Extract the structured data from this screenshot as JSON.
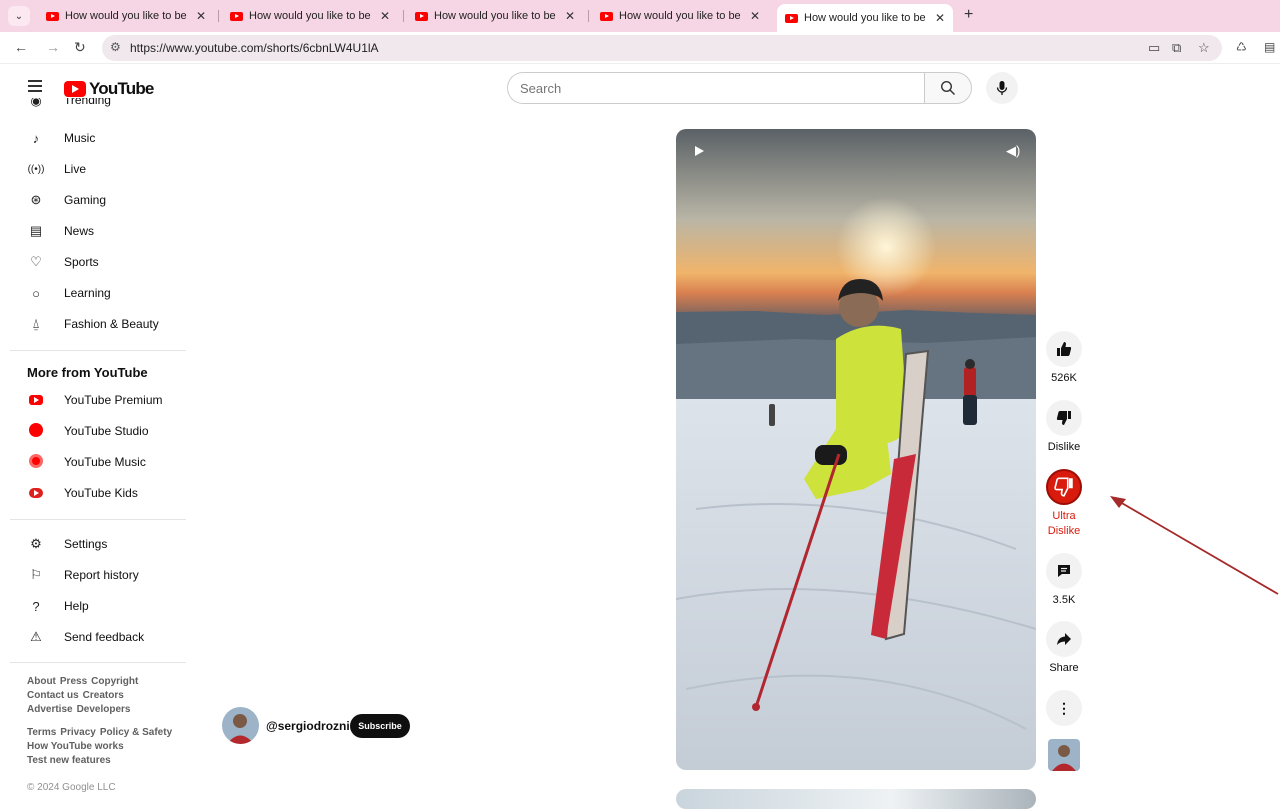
{
  "browser": {
    "tabs": [
      {
        "title": "How would you like to be gr",
        "active": false
      },
      {
        "title": "How would you like to be gr",
        "active": false
      },
      {
        "title": "How would you like to be gr",
        "active": false
      },
      {
        "title": "How would you like to be gr",
        "active": false
      },
      {
        "title": "How would you like to be gr",
        "active": true
      }
    ],
    "url": "https://www.youtube.com/shorts/6cbnLW4U1lA"
  },
  "header": {
    "logo_text": "YouTube",
    "search_placeholder": "Search"
  },
  "sidebar": {
    "partial_item": "Trending",
    "items": [
      {
        "label": "Music",
        "icon": "music-note-icon"
      },
      {
        "label": "Live",
        "icon": "live-broadcast-icon"
      },
      {
        "label": "Gaming",
        "icon": "gamepad-icon"
      },
      {
        "label": "News",
        "icon": "newspaper-icon"
      },
      {
        "label": "Sports",
        "icon": "trophy-icon"
      },
      {
        "label": "Learning",
        "icon": "lightbulb-icon"
      },
      {
        "label": "Fashion & Beauty",
        "icon": "hanger-icon"
      }
    ],
    "more_title": "More from YouTube",
    "more_items": [
      {
        "label": "YouTube Premium",
        "color": "#ff0000"
      },
      {
        "label": "YouTube Studio",
        "color": "#ff0000"
      },
      {
        "label": "YouTube Music",
        "color": "#ff0000"
      },
      {
        "label": "YouTube Kids",
        "color": "#ff0000"
      }
    ],
    "settings_items": [
      {
        "label": "Settings",
        "icon": "gear-icon"
      },
      {
        "label": "Report history",
        "icon": "flag-icon"
      },
      {
        "label": "Help",
        "icon": "help-icon"
      },
      {
        "label": "Send feedback",
        "icon": "feedback-icon"
      }
    ],
    "footer": {
      "line1": [
        "About",
        "Press",
        "Copyright"
      ],
      "line2": [
        "Contact us",
        "Creators"
      ],
      "line3": [
        "Advertise",
        "Developers"
      ],
      "line4": [
        "Terms",
        "Privacy",
        "Policy & Safety"
      ],
      "line5": [
        "How YouTube works"
      ],
      "line6": [
        "Test new features"
      ],
      "copyright": "© 2024 Google LLC"
    }
  },
  "short": {
    "channel": "@sergiodroznini",
    "subscribe_label": "Subscribe",
    "actions": {
      "like_count": "526K",
      "dislike_label": "Dislike",
      "ultra_dislike_line1": "Ultra",
      "ultra_dislike_line2": "Dislike",
      "comment_count": "3.5K",
      "share_label": "Share"
    }
  },
  "colors": {
    "brand_red": "#ff0000",
    "ultra_dislike_red": "#d81b0d",
    "annotation_arrow": "#a52a2a"
  }
}
